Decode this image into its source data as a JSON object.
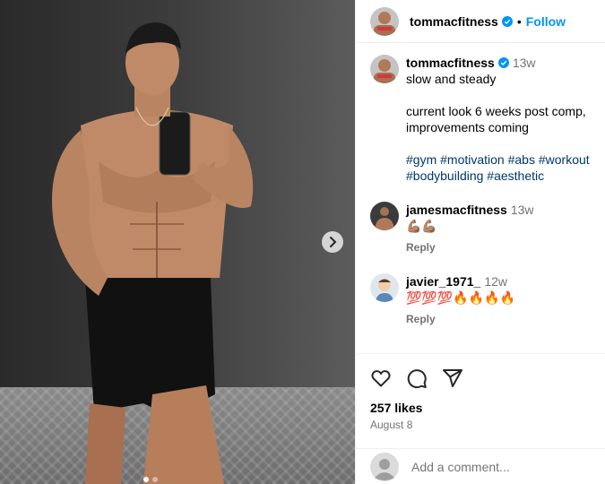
{
  "post": {
    "author": "tommacfitness",
    "follow_label": "Follow",
    "separator": "•",
    "likes": "257 likes",
    "date": "August 8",
    "add_comment_placeholder": "Add a comment..."
  },
  "caption": {
    "author": "tommacfitness",
    "time": "13w",
    "text": "slow and steady\n\ncurrent look 6 weeks post comp, improvements coming",
    "hashtags": [
      "#gym",
      "#motivation",
      "#abs",
      "#workout",
      "#bodybuilding",
      "#aesthetic"
    ]
  },
  "comments": [
    {
      "user": "jamesmacfitness",
      "time": "13w",
      "text": "💪🏽💪🏽",
      "reply_label": "Reply"
    },
    {
      "user": "javier_1971_",
      "time": "12w",
      "text": "💯💯💯🔥🔥🔥🔥",
      "reply_label": "Reply"
    }
  ],
  "icons": {
    "verified": "verified-badge-icon",
    "like": "heart-icon",
    "comment": "comment-bubble-icon",
    "share": "paper-plane-icon",
    "next": "chevron-right-icon"
  },
  "colors": {
    "link_blue": "#0095f6",
    "hashtag": "#00376b",
    "muted": "#737373",
    "border": "#efefef"
  },
  "carousel": {
    "slide_count": 2,
    "active_slide": 1
  }
}
